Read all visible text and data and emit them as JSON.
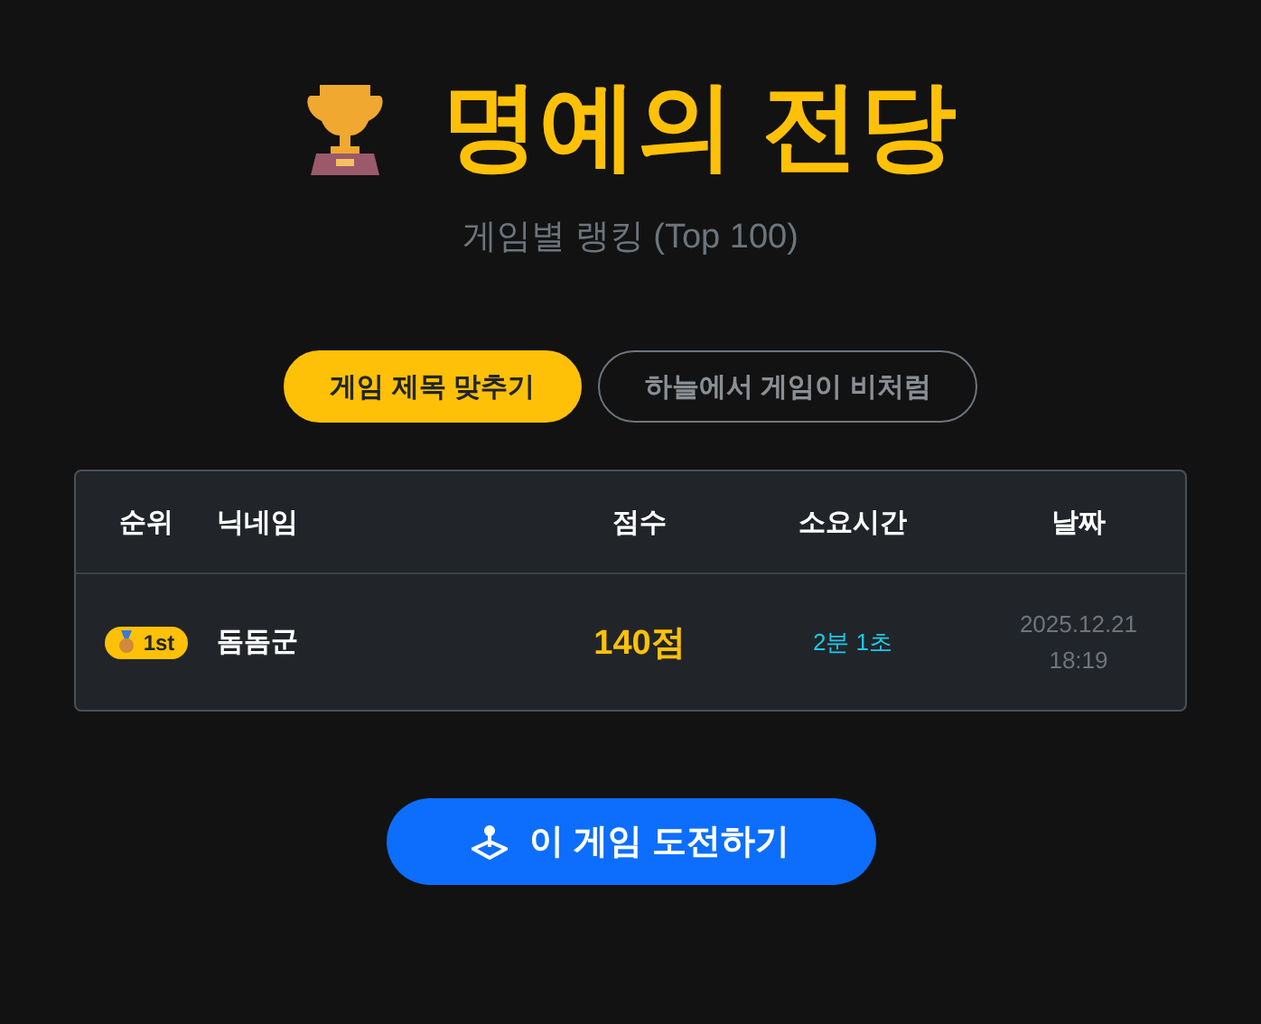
{
  "title": "명예의 전당",
  "subtitle": "게임별 랭킹 (Top 100)",
  "tabs": [
    {
      "label": "게임 제목 맞추기",
      "selected": true
    },
    {
      "label": "하늘에서 게임이 비처럼",
      "selected": false
    }
  ],
  "table": {
    "columns": [
      "순위",
      "닉네임",
      "점수",
      "소요시간",
      "날짜"
    ],
    "rows": [
      {
        "rank": "1st",
        "nickname": "돔돔군",
        "score": "140점",
        "time": "2분 1초",
        "date": "2025.12.21",
        "clock": "18:19"
      }
    ]
  },
  "play_button": "이 게임 도전하기"
}
